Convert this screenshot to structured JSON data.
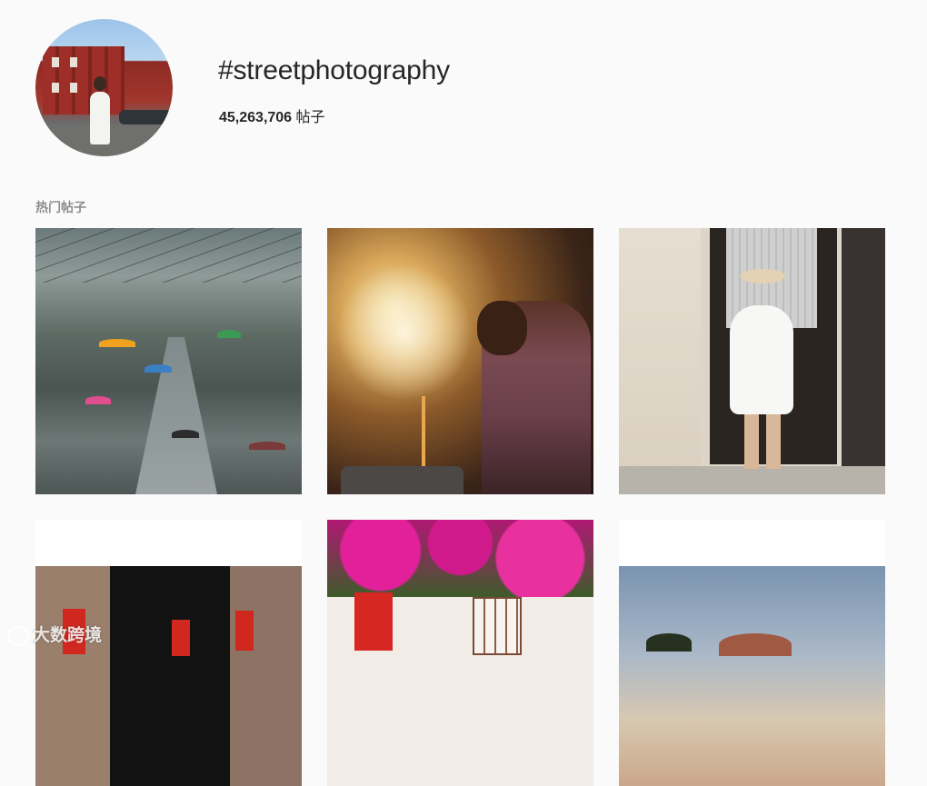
{
  "header": {
    "hashtag": "#streetphotography",
    "post_count": "45,263,706",
    "post_count_unit": "帖子"
  },
  "sections": {
    "top_posts_label": "热门帖子"
  },
  "posts": [
    {
      "subject": "rainy crowded street with umbrellas"
    },
    {
      "subject": "street vendor pouring with steam"
    },
    {
      "subject": "woman in white dress at doorway"
    },
    {
      "subject": "people in red walking past dark doorway"
    },
    {
      "subject": "pink bougainvillea over red door"
    },
    {
      "subject": "palm trees and dome under cloudy sky"
    }
  ],
  "watermark": {
    "text": "大数跨境"
  }
}
